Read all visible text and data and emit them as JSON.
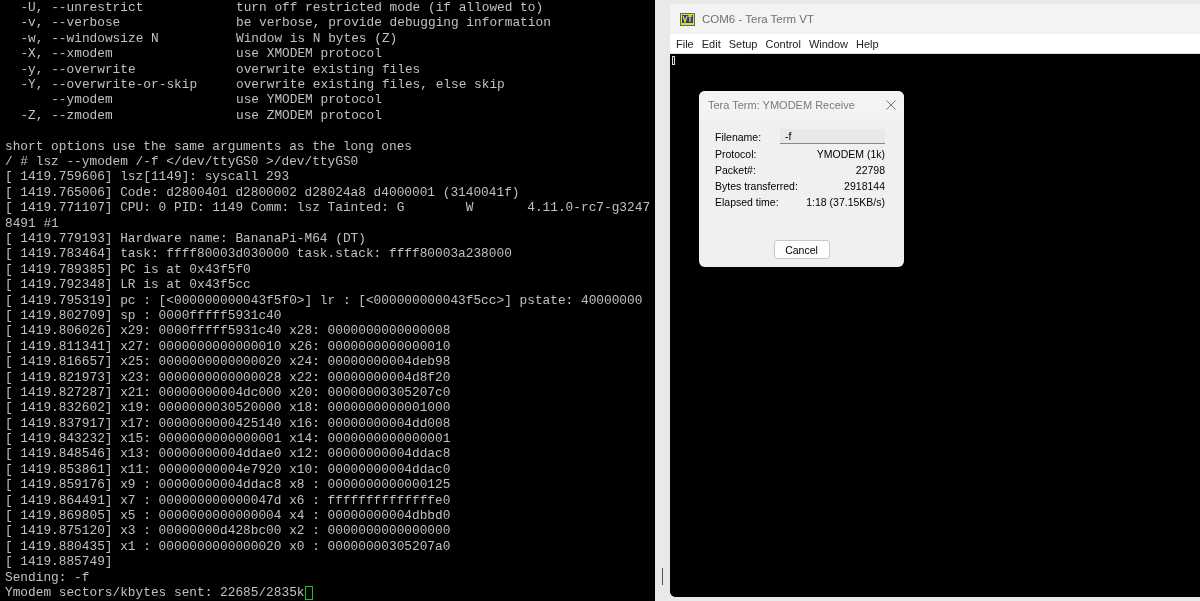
{
  "terminal": {
    "options": [
      {
        "short": "-U,",
        "long": "--unrestrict",
        "description": "turn off restricted mode (if allowed to)"
      },
      {
        "short": "-v,",
        "long": "--verbose",
        "description": "be verbose, provide debugging information"
      },
      {
        "short": "-w,",
        "long": "--windowsize N",
        "description": "Window is N bytes (Z)"
      },
      {
        "short": "-X,",
        "long": "--xmodem",
        "description": "use XMODEM protocol"
      },
      {
        "short": "-y,",
        "long": "--overwrite",
        "description": "overwrite existing files"
      },
      {
        "short": "-Y,",
        "long": "--overwrite-or-skip",
        "description": "overwrite existing files, else skip"
      },
      {
        "long": "--ymodem",
        "description": "use YMODEM protocol"
      },
      {
        "short": "-Z,",
        "long": "--zmodem",
        "description": "use ZMODEM protocol"
      }
    ],
    "lines": [
      "short options use the same arguments as the long ones",
      "/ # lsz --ymodem /-f </dev/ttyGS0 >/dev/ttyGS0",
      "[ 1419.759606] lsz[1149]: syscall 293",
      "[ 1419.765006] Code: d2800401 d2800002 d28024a8 d4000001 (3140041f)",
      "[ 1419.771107] CPU: 0 PID: 1149 Comm: lsz Tainted: G        W       4.11.0-rc7-g3247",
      "8491 #1",
      "[ 1419.779193] Hardware name: BananaPi-M64 (DT)",
      "[ 1419.783464] task: ffff80003d030000 task.stack: ffff80003a238000",
      "[ 1419.789385] PC is at 0x43f5f0",
      "[ 1419.792348] LR is at 0x43f5cc",
      "[ 1419.795319] pc : [<000000000043f5f0>] lr : [<000000000043f5cc>] pstate: 40000000",
      "[ 1419.802709] sp : 0000fffff5931c40",
      "[ 1419.806026] x29: 0000fffff5931c40 x28: 0000000000000008",
      "[ 1419.811341] x27: 0000000000000010 x26: 0000000000000010",
      "[ 1419.816657] x25: 0000000000000020 x24: 00000000004deb98",
      "[ 1419.821973] x23: 0000000000000028 x22: 00000000004d8f20",
      "[ 1419.827287] x21: 00000000004dc000 x20: 00000000305207c0",
      "[ 1419.832602] x19: 0000000030520000 x18: 0000000000001000",
      "[ 1419.837917] x17: 0000000000425140 x16: 00000000004dd008",
      "[ 1419.843232] x15: 0000000000000001 x14: 0000000000000001",
      "[ 1419.848546] x13: 00000000004ddae0 x12: 00000000004ddac8",
      "[ 1419.853861] x11: 00000000004e7920 x10: 00000000004ddac0",
      "[ 1419.859176] x9 : 00000000004ddac8 x8 : 0000000000000125",
      "[ 1419.864491] x7 : 000000000000047d x6 : ffffffffffffffe0",
      "[ 1419.869805] x5 : 0000000000000004 x4 : 00000000004dbbd0",
      "[ 1419.875120] x3 : 00000000d428bc00 x2 : 0000000000000000",
      "[ 1419.880435] x1 : 0000000000000020 x0 : 00000000305207a0",
      "[ 1419.885749]",
      "Sending: -f",
      "Ymodem sectors/kbytes sent: 22685/2835k"
    ]
  },
  "window": {
    "title": "COM6 - Tera Term VT",
    "menu": [
      "File",
      "Edit",
      "Setup",
      "Control",
      "Window",
      "Help"
    ]
  },
  "dialog": {
    "title": "Tera Term: YMODEM Receive",
    "filename": {
      "label": "Filename:",
      "value": "-f"
    },
    "fields": [
      {
        "label": "Protocol:",
        "value": "YMODEM (1k)"
      },
      {
        "label": "Packet#:",
        "value": "22798"
      },
      {
        "label": "Bytes transferred:",
        "value": "2918144"
      },
      {
        "label": "Elapsed time:",
        "value": "1:18 (37.15KB/s)"
      }
    ],
    "button": "Cancel"
  }
}
